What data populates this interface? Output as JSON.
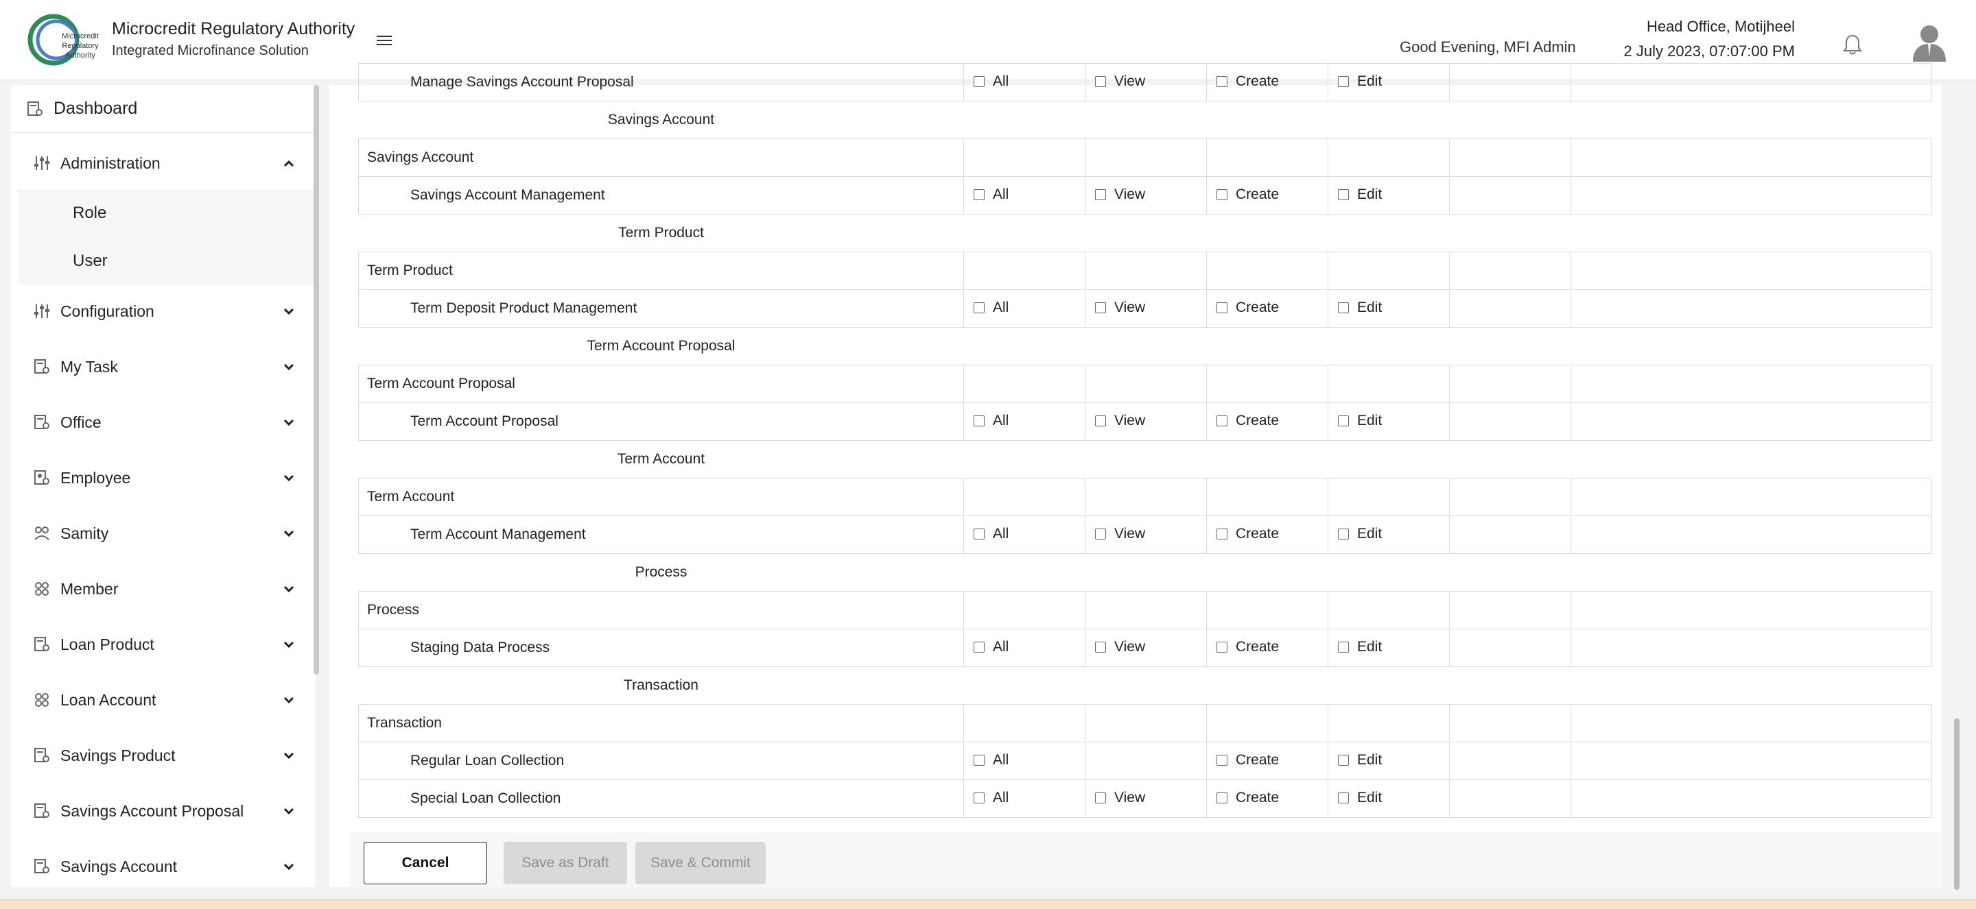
{
  "header": {
    "brand_title": "Microcredit Regulatory Authority",
    "brand_subtitle": "Integrated Microfinance Solution",
    "logo_text": [
      "Microcredit",
      "Regulatory",
      "Authority"
    ],
    "greeting": "Good Evening, MFI Admin",
    "office": "Head Office, Motijheel",
    "datetime": "2 July 2023, 07:07:00 PM"
  },
  "sidebar": {
    "dashboard": "Dashboard",
    "admin": "Administration",
    "admin_sub": [
      "Role",
      "User"
    ],
    "items": [
      {
        "label": "Configuration",
        "icon": "sliders-icon"
      },
      {
        "label": "My Task",
        "icon": "document-icon"
      },
      {
        "label": "Office",
        "icon": "document-icon"
      },
      {
        "label": "Employee",
        "icon": "employee-icon"
      },
      {
        "label": "Samity",
        "icon": "group-icon"
      },
      {
        "label": "Member",
        "icon": "members-icon"
      },
      {
        "label": "Loan Product",
        "icon": "document-icon"
      },
      {
        "label": "Loan Account",
        "icon": "members-icon"
      },
      {
        "label": "Savings Product",
        "icon": "document-icon"
      },
      {
        "label": "Savings Account Proposal",
        "icon": "document-icon"
      },
      {
        "label": "Savings Account",
        "icon": "document-icon"
      }
    ]
  },
  "permissions": {
    "labels": {
      "all": "All",
      "view": "View",
      "create": "Create",
      "edit": "Edit"
    },
    "rows": [
      {
        "type": "child",
        "name": "Manage Savings Account Proposal",
        "all": true,
        "view": true,
        "create": true,
        "edit": true
      },
      {
        "type": "section",
        "name": "Savings Account"
      },
      {
        "type": "group",
        "name": "Savings Account"
      },
      {
        "type": "child",
        "name": "Savings Account Management",
        "all": true,
        "view": true,
        "create": true,
        "edit": true
      },
      {
        "type": "section",
        "name": "Term Product"
      },
      {
        "type": "group",
        "name": "Term Product"
      },
      {
        "type": "child",
        "name": "Term Deposit Product Management",
        "all": true,
        "view": true,
        "create": true,
        "edit": true
      },
      {
        "type": "section",
        "name": "Term Account Proposal"
      },
      {
        "type": "group",
        "name": "Term Account Proposal"
      },
      {
        "type": "child",
        "name": "Term Account Proposal",
        "all": true,
        "view": true,
        "create": true,
        "edit": true
      },
      {
        "type": "section",
        "name": "Term Account"
      },
      {
        "type": "group",
        "name": "Term Account"
      },
      {
        "type": "child",
        "name": "Term Account Management",
        "all": true,
        "view": true,
        "create": true,
        "edit": true
      },
      {
        "type": "section",
        "name": "Process"
      },
      {
        "type": "group",
        "name": "Process"
      },
      {
        "type": "child",
        "name": "Staging Data Process",
        "all": true,
        "view": true,
        "create": true,
        "edit": true
      },
      {
        "type": "section",
        "name": "Transaction"
      },
      {
        "type": "group",
        "name": "Transaction"
      },
      {
        "type": "child",
        "name": "Regular Loan Collection",
        "all": true,
        "view": false,
        "create": true,
        "edit": true
      },
      {
        "type": "child",
        "name": "Special Loan Collection",
        "all": true,
        "view": true,
        "create": true,
        "edit": true
      }
    ]
  },
  "footer": {
    "cancel": "Cancel",
    "save_draft": "Save as Draft",
    "save_commit": "Save & Commit"
  }
}
